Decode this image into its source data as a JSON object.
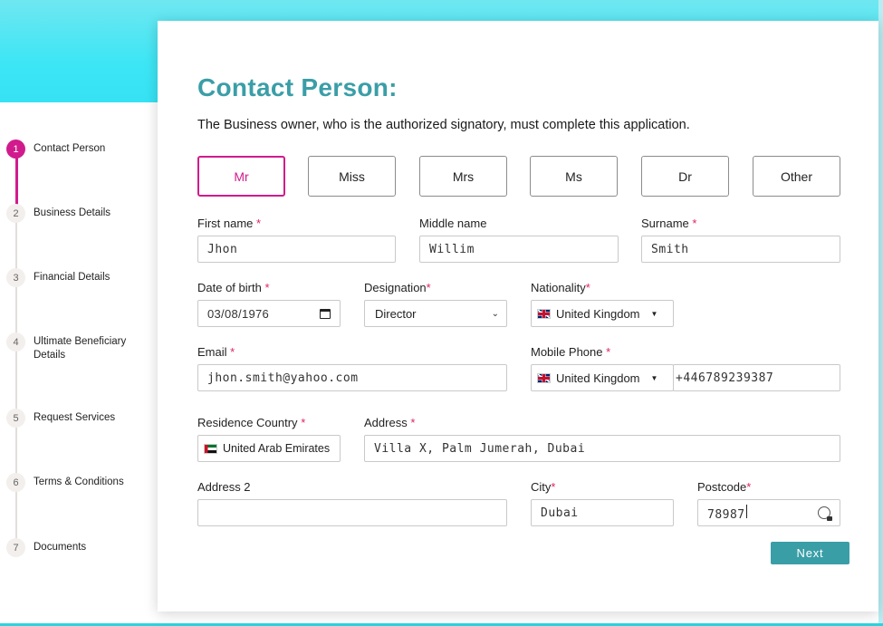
{
  "colors": {
    "accent": "#3a9ea7",
    "active_step": "#d11b8d",
    "header_band": "#3ee6f5"
  },
  "steps": [
    {
      "num": "1",
      "label": "Contact Person"
    },
    {
      "num": "2",
      "label": "Business Details"
    },
    {
      "num": "3",
      "label": "Financial Details"
    },
    {
      "num": "4",
      "label": "Ultimate Beneficiary Details"
    },
    {
      "num": "5",
      "label": "Request Services"
    },
    {
      "num": "6",
      "label": "Terms & Conditions"
    },
    {
      "num": "7",
      "label": "Documents"
    }
  ],
  "form": {
    "title": "Contact Person:",
    "subtitle": "The Business owner, who is the authorized signatory, must complete this application.",
    "salutations": [
      "Mr",
      "Miss",
      "Mrs",
      "Ms",
      "Dr",
      "Other"
    ],
    "selected_salutation": "Mr",
    "first_name": {
      "label": "First name",
      "value": "Jhon"
    },
    "middle_name": {
      "label": "Middle name",
      "value": "Willim"
    },
    "surname": {
      "label": "Surname",
      "value": "Smith"
    },
    "dob": {
      "label": "Date of birth",
      "value": "03/08/1976"
    },
    "designation": {
      "label": "Designation",
      "value": "Director"
    },
    "nationality": {
      "label": "Nationality",
      "value": "United Kingdom",
      "flag": "uk-flag-icon"
    },
    "email": {
      "label": "Email",
      "value": "jhon.smith@yahoo.com"
    },
    "mobile": {
      "label": "Mobile Phone",
      "country": "United Kingdom",
      "value": "+446789239387"
    },
    "residence_country": {
      "label": "Residence Country",
      "value": "United Arab Emirates",
      "flag": "uae-flag-icon"
    },
    "address": {
      "label": "Address",
      "value": "Villa X, Palm Jumerah, Dubai"
    },
    "address2": {
      "label": "Address 2",
      "value": ""
    },
    "city": {
      "label": "City",
      "value": "Dubai"
    },
    "postcode": {
      "label": "Postcode",
      "value": "78987"
    },
    "required_mark": "*",
    "next_label": "Next"
  }
}
